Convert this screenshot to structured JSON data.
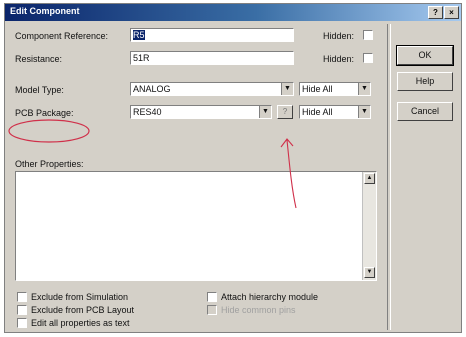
{
  "window": {
    "title": "Edit Component",
    "help_btn": "?",
    "close_btn": "×"
  },
  "fields": {
    "component_reference": {
      "label": "Component Reference:",
      "value": "R5"
    },
    "resistance": {
      "label": "Resistance:",
      "value": "51R"
    },
    "model_type": {
      "label": "Model Type:",
      "value": "ANALOG"
    },
    "pcb_package": {
      "label": "PCB Package:",
      "value": "RES40",
      "browse_btn": "?"
    },
    "other_properties": {
      "label": "Other Properties:"
    }
  },
  "hidden_labels": {
    "component_reference": "Hidden:",
    "resistance": "Hidden:"
  },
  "hide_selects": {
    "model_type": "Hide All",
    "pcb_package": "Hide All"
  },
  "buttons": {
    "ok": "OK",
    "help": "Help",
    "cancel": "Cancel"
  },
  "checkboxes": [
    {
      "label": "Exclude from Simulation",
      "checked": false
    },
    {
      "label": "Exclude from PCB Layout",
      "checked": false
    },
    {
      "label": "Edit all properties as text",
      "checked": false
    },
    {
      "label": "Attach hierarchy module",
      "checked": false
    },
    {
      "label": "Hide common pins",
      "checked": false,
      "disabled": true
    }
  ],
  "annotation": {
    "color": "#d0304a"
  }
}
